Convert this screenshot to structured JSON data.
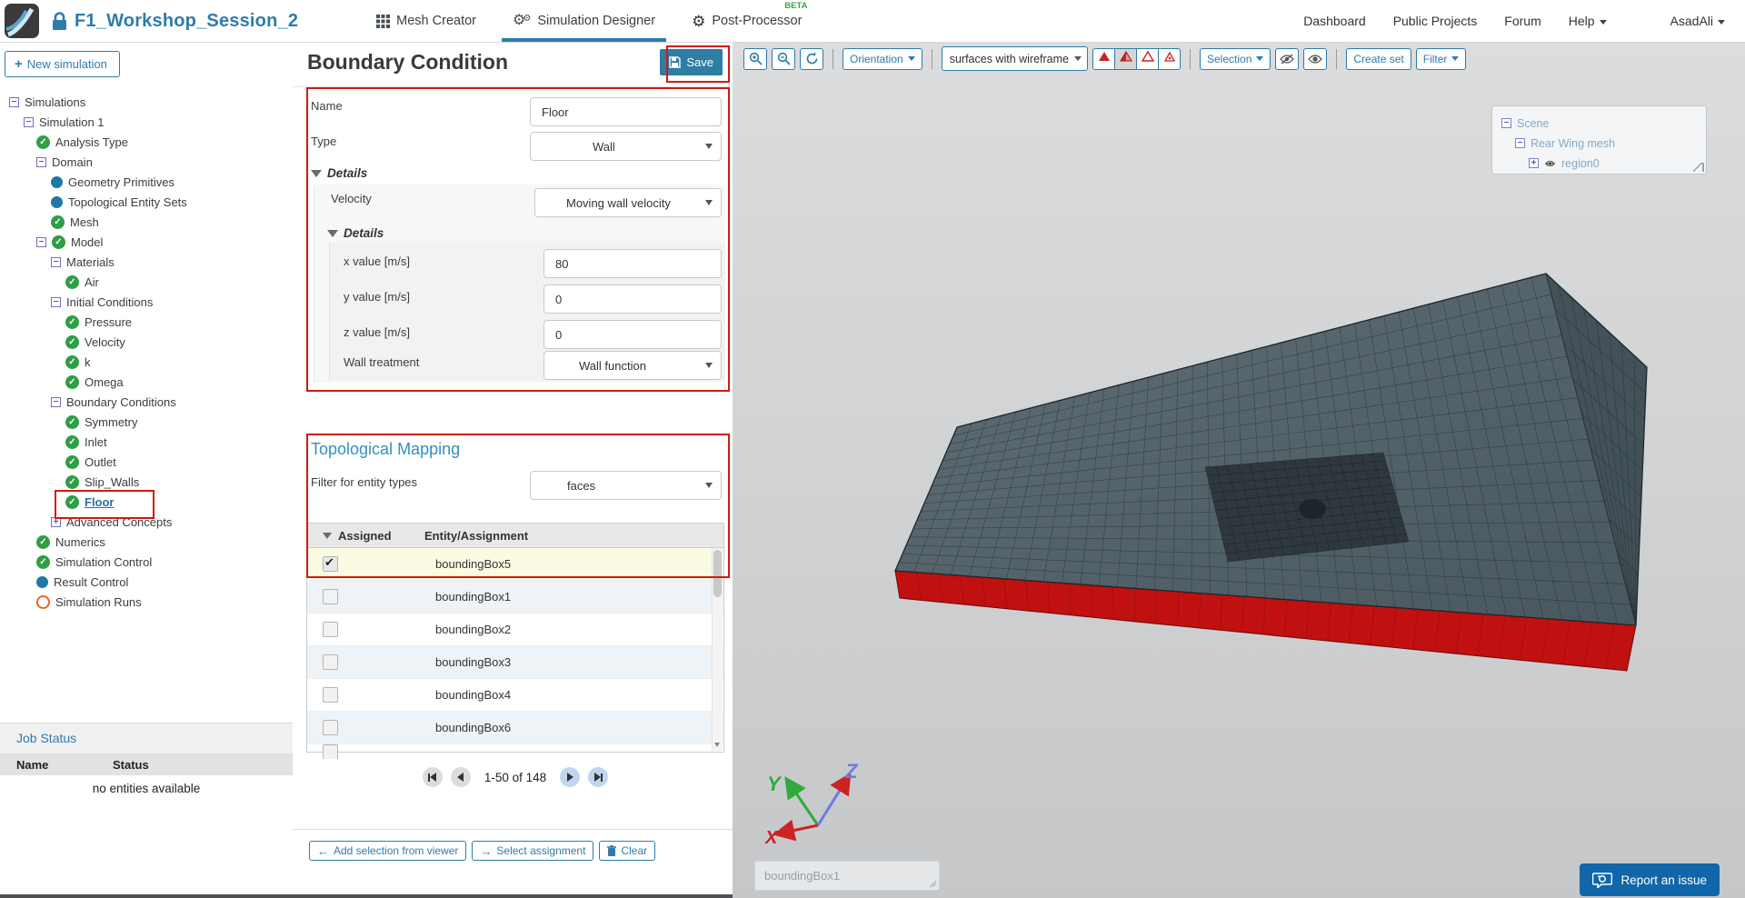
{
  "header": {
    "project_title": "F1_Workshop_Session_2",
    "tabs": [
      {
        "label": "Mesh Creator",
        "icon": "grid-icon",
        "active": false,
        "beta": ""
      },
      {
        "label": "Simulation Designer",
        "icon": "gears-icon",
        "active": true,
        "beta": ""
      },
      {
        "label": "Post-Processor",
        "icon": "gear-icon",
        "active": false,
        "beta": "BETA"
      }
    ],
    "nav": [
      "Dashboard",
      "Public Projects",
      "Forum"
    ],
    "help_label": "Help",
    "user_label": "AsadAli"
  },
  "sidebar": {
    "new_simulation_label": "New simulation",
    "tree": [
      {
        "label": "Simulations",
        "level": 0,
        "icons": [
          "minus"
        ]
      },
      {
        "label": "Simulation 1",
        "level": 1,
        "icons": [
          "minus"
        ]
      },
      {
        "label": "Analysis Type",
        "level": 2,
        "icons": [
          "check"
        ]
      },
      {
        "label": "Domain",
        "level": 2,
        "icons": [
          "minus"
        ]
      },
      {
        "label": "Geometry Primitives",
        "level": 3,
        "icons": [
          "dot"
        ]
      },
      {
        "label": "Topological Entity Sets",
        "level": 3,
        "icons": [
          "dot"
        ]
      },
      {
        "label": "Mesh",
        "level": 3,
        "icons": [
          "check"
        ]
      },
      {
        "label": "Model",
        "level": 2,
        "icons": [
          "minus",
          "check"
        ]
      },
      {
        "label": "Materials",
        "level": 3,
        "icons": [
          "minus"
        ]
      },
      {
        "label": "Air",
        "level": 4,
        "icons": [
          "check"
        ]
      },
      {
        "label": "Initial Conditions",
        "level": 3,
        "icons": [
          "minus"
        ]
      },
      {
        "label": "Pressure",
        "level": 4,
        "icons": [
          "check"
        ]
      },
      {
        "label": "Velocity",
        "level": 4,
        "icons": [
          "check"
        ]
      },
      {
        "label": "k",
        "level": 4,
        "icons": [
          "check"
        ]
      },
      {
        "label": "Omega",
        "level": 4,
        "icons": [
          "check"
        ]
      },
      {
        "label": "Boundary Conditions",
        "level": 3,
        "icons": [
          "minus"
        ]
      },
      {
        "label": "Symmetry",
        "level": 4,
        "icons": [
          "check"
        ]
      },
      {
        "label": "Inlet",
        "level": 4,
        "icons": [
          "check"
        ]
      },
      {
        "label": "Outlet",
        "level": 4,
        "icons": [
          "check"
        ]
      },
      {
        "label": "Slip_Walls",
        "level": 4,
        "icons": [
          "check"
        ]
      },
      {
        "label": "Floor",
        "level": 4,
        "icons": [
          "check"
        ],
        "selected": true
      },
      {
        "label": "Advanced Concepts",
        "level": 3,
        "icons": [
          "plus"
        ]
      },
      {
        "label": "Numerics",
        "level": 2,
        "icons": [
          "check"
        ]
      },
      {
        "label": "Simulation Control",
        "level": 2,
        "icons": [
          "check"
        ]
      },
      {
        "label": "Result Control",
        "level": 2,
        "icons": [
          "dot"
        ]
      },
      {
        "label": "Simulation Runs",
        "level": 2,
        "icons": [
          "ring"
        ]
      }
    ],
    "job_status": {
      "title": "Job Status",
      "columns": [
        "Name",
        "Status"
      ],
      "empty_text": "no entities available"
    }
  },
  "panel": {
    "title": "Boundary Condition",
    "save_label": "Save",
    "form": {
      "name_label": "Name",
      "name_value": "Floor",
      "type_label": "Type",
      "type_value": "Wall"
    },
    "details": {
      "outer_label": "Details",
      "velocity_label": "Velocity",
      "velocity_value": "Moving wall velocity",
      "inner_label": "Details",
      "value_rows": [
        {
          "label": "x value [m/s]",
          "value": "80"
        },
        {
          "label": "y value [m/s]",
          "value": "0"
        },
        {
          "label": "z value [m/s]",
          "value": "0"
        }
      ],
      "wall_treatment_label": "Wall treatment",
      "wall_treatment_value": "Wall function"
    },
    "topological_mapping": {
      "title": "Topological Mapping",
      "filter_label": "Filter for entity types",
      "filter_value": "faces",
      "columns": {
        "assigned": "Assigned",
        "entity": "Entity/Assignment"
      },
      "rows": [
        {
          "label": "boundingBox5",
          "assigned": true,
          "selected": true
        },
        {
          "label": "boundingBox1",
          "assigned": false
        },
        {
          "label": "boundingBox2",
          "assigned": false
        },
        {
          "label": "boundingBox3",
          "assigned": false
        },
        {
          "label": "boundingBox4",
          "assigned": false
        },
        {
          "label": "boundingBox6",
          "assigned": false
        },
        {
          "label": "",
          "assigned": false,
          "partial": true
        }
      ]
    },
    "pagination": {
      "text": "1-50 of 148"
    },
    "actions": [
      {
        "icon": "arrow-left-icon",
        "label": "Add selection from viewer"
      },
      {
        "icon": "arrow-right-icon",
        "label": "Select assignment"
      },
      {
        "icon": "trash-icon",
        "label": "Clear"
      }
    ]
  },
  "viewer": {
    "toolbar": {
      "orientation_label": "Orientation",
      "render_mode_value": "surfaces with wireframe",
      "render_modes": [
        {
          "name": "surfaces",
          "active": false
        },
        {
          "name": "surfaces-with-wireframe",
          "active": true
        },
        {
          "name": "wireframe",
          "active": false
        },
        {
          "name": "points",
          "active": false
        }
      ],
      "selection_label": "Selection",
      "create_set_label": "Create set",
      "filter_label": "Filter"
    },
    "scene_tree": {
      "items": [
        {
          "label": "Scene",
          "level": 0,
          "icon": "minus"
        },
        {
          "label": "Rear Wing mesh",
          "level": 1,
          "icon": "minus"
        },
        {
          "label": "region0",
          "level": 2,
          "icon": "plus",
          "eye": true
        }
      ]
    },
    "axes": {
      "x": "X",
      "y": "Y",
      "z": "Z"
    },
    "bottom_input_value": "boundingBox1",
    "report_issue_label": "Report an issue"
  },
  "colors": {
    "accent_blue": "#2e7cab",
    "save_button": "#2e7da3",
    "highlight_red": "#d11a12",
    "check_green": "#2f9e44",
    "node_blue": "#2178a8",
    "runs_orange": "#e8622d",
    "topo_heading": "#3390c3",
    "beta_green": "#2faa44",
    "mesh_face": "#55646b",
    "mesh_floor_red": "#c01010"
  }
}
